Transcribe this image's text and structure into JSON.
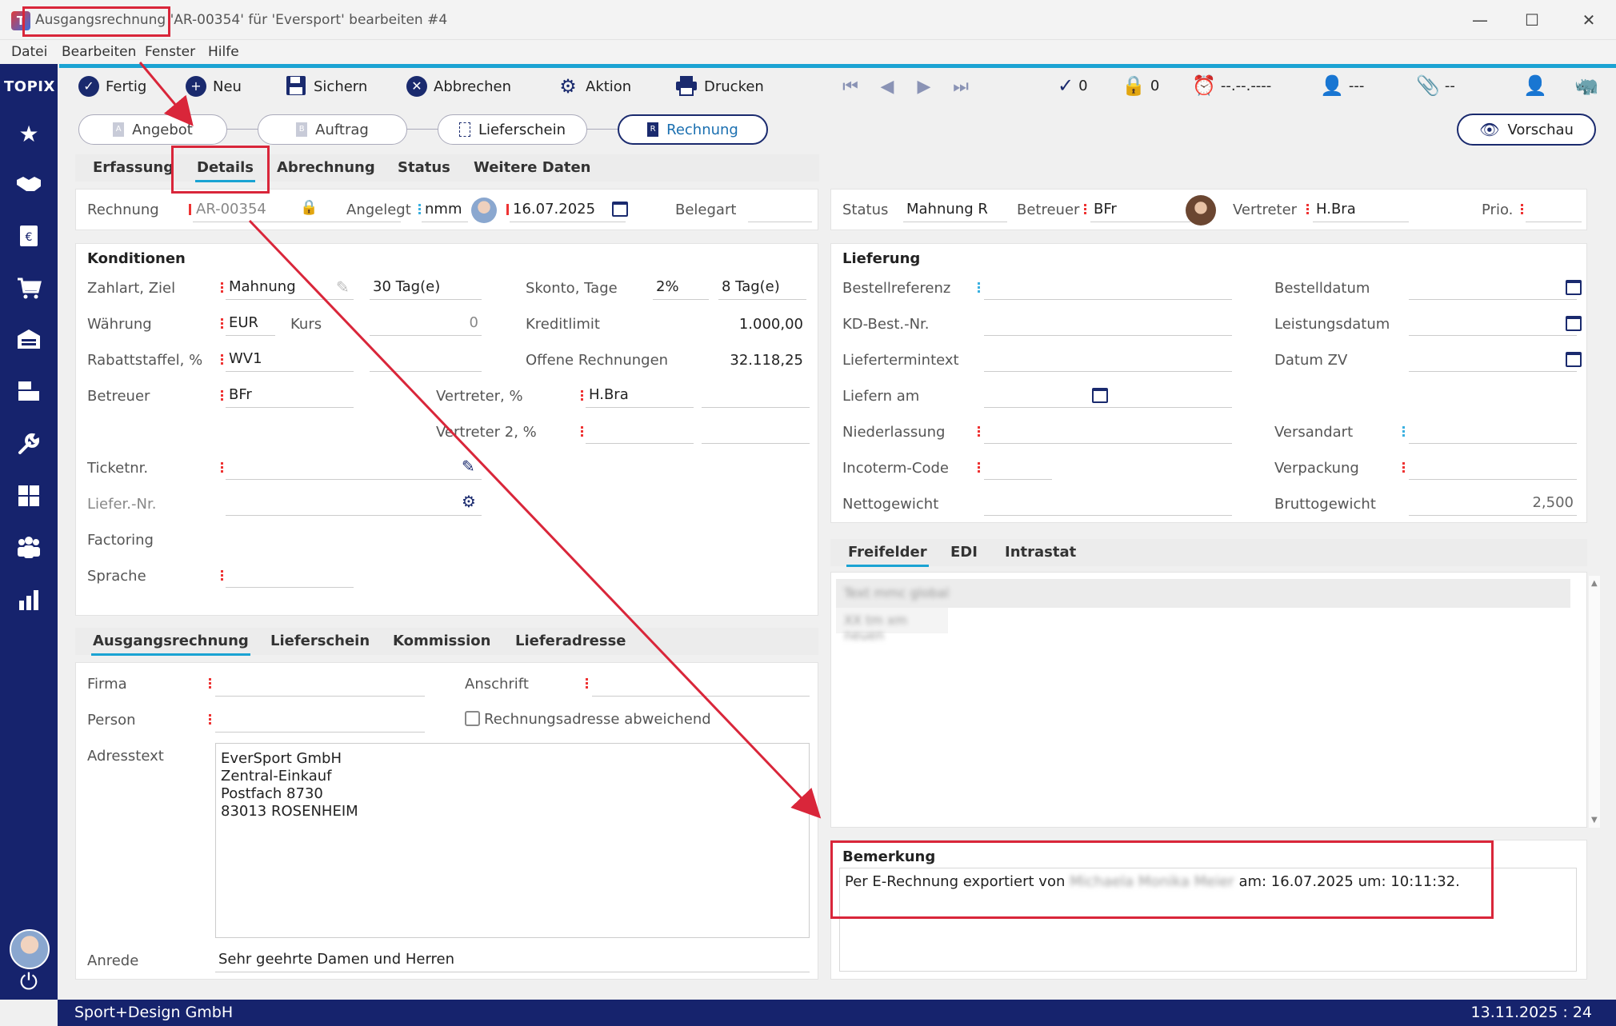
{
  "window": {
    "title": "Ausgangsrechnung 'AR-00354' für 'Eversport' bearbeiten #4",
    "logo_letter": "T"
  },
  "menu": [
    "Datei",
    "Bearbeiten",
    "Fenster",
    "Hilfe"
  ],
  "sidebar": {
    "brand": "TOPIX",
    "icons": [
      "star-icon",
      "handshake-icon",
      "invoice-icon",
      "cart-icon",
      "warehouse-icon",
      "archive-icon",
      "wrench-icon",
      "calculator-icon",
      "team-icon",
      "bar-chart-icon"
    ],
    "power_icon": "power-icon"
  },
  "toolbar": {
    "fertig": "Fertig",
    "neu": "Neu",
    "sichern": "Sichern",
    "abbrechen": "Abbrechen",
    "aktion": "Aktion",
    "drucken": "Drucken",
    "check_count": "0",
    "lock_count": "0",
    "alarm_text": "--.--.----",
    "user_text": "---",
    "attach_text": "--"
  },
  "workflow": {
    "angebot": "Angebot",
    "auftrag": "Auftrag",
    "lieferschein": "Lieferschein",
    "rechnung": "Rechnung",
    "vorschau": "Vorschau"
  },
  "main_tabs": [
    "Erfassung",
    "Details",
    "Abrechnung",
    "Status",
    "Weitere Daten"
  ],
  "header": {
    "rechnung_label": "Rechnung",
    "rechnung_value": "AR-00354",
    "angelegt_label": "Angelegt",
    "angelegt_user": "nmm",
    "angelegt_date": "16.07.2025",
    "belegart_label": "Belegart",
    "status_label": "Status",
    "status_value": "Mahnung R",
    "betreuer_label": "Betreuer",
    "betreuer_value": "BFr",
    "vertreter_label": "Vertreter",
    "vertreter_value": "H.Bra",
    "prio_label": "Prio."
  },
  "konditionen": {
    "title": "Konditionen",
    "zahlart_label": "Zahlart, Ziel",
    "zahlart_value": "Mahnung",
    "ziel_value": "30 Tag(e)",
    "skonto_label": "Skonto, Tage",
    "skonto_pct": "2%",
    "skonto_days": "8 Tag(e)",
    "waehrung_label": "Währung",
    "waehrung_value": "EUR",
    "kurs_label": "Kurs",
    "kurs_value": "0",
    "kreditlimit_label": "Kreditlimit",
    "kreditlimit_value": "1.000,00",
    "rabatt_label": "Rabattstaffel, %",
    "rabatt_value": "WV1",
    "offene_label": "Offene Rechnungen",
    "offene_value": "32.118,25",
    "betreuer_label": "Betreuer",
    "betreuer_value": "BFr",
    "vertreter_label": "Vertreter, %",
    "vertreter_value": "H.Bra",
    "vertreter2_label": "Vertreter 2, %",
    "ticket_label": "Ticketnr.",
    "lieferNr_label": "Liefer.-Nr.",
    "factoring_label": "Factoring",
    "sprache_label": "Sprache"
  },
  "lieferung": {
    "title": "Lieferung",
    "bestellref_label": "Bestellreferenz",
    "kdbest_label": "KD-Best.-Nr.",
    "liefertermintext_label": "Liefertermintext",
    "liefern_am_label": "Liefern am",
    "niederlassung_label": "Niederlassung",
    "incoterm_label": "Incoterm-Code",
    "nettogewicht_label": "Nettogewicht",
    "bestelldatum_label": "Bestelldatum",
    "leistungsdatum_label": "Leistungsdatum",
    "datumzv_label": "Datum ZV",
    "versandart_label": "Versandart",
    "verpackung_label": "Verpackung",
    "bruttogewicht_label": "Bruttogewicht",
    "bruttogewicht_value": "2,500"
  },
  "lower_tabs": [
    "Ausgangsrechnung",
    "Lieferschein",
    "Kommission",
    "Lieferadresse"
  ],
  "address": {
    "firma_label": "Firma",
    "anschrift_label": "Anschrift",
    "person_label": "Person",
    "abweichend_label": "Rechnungsadresse abweichend",
    "adresstext_label": "Adresstext",
    "adresstext": "EverSport GmbH\nZentral-Einkauf\nPostfach 8730\n83013 ROSENHEIM",
    "anrede_label": "Anrede",
    "anrede_value": "Sehr geehrte Damen und Herren"
  },
  "right_tabs": [
    "Freifelder",
    "EDI",
    "Intrastat"
  ],
  "freifelder_rows": [
    "Text mmc global",
    "XX tm xm neuen"
  ],
  "bemerkung": {
    "title": "Bemerkung",
    "prefix": "Per E-Rechnung exportiert von",
    "name_blurred": "Michaela Monika Meier",
    "suffix": "am: 16.07.2025 um: 10:11:32."
  },
  "footer": {
    "company": "Sport+Design GmbH",
    "date": "13.11.2025 : 24"
  },
  "colors": {
    "accent": "#16236d",
    "cyan": "#1aa3d3",
    "annotation_red": "#d9263a"
  }
}
